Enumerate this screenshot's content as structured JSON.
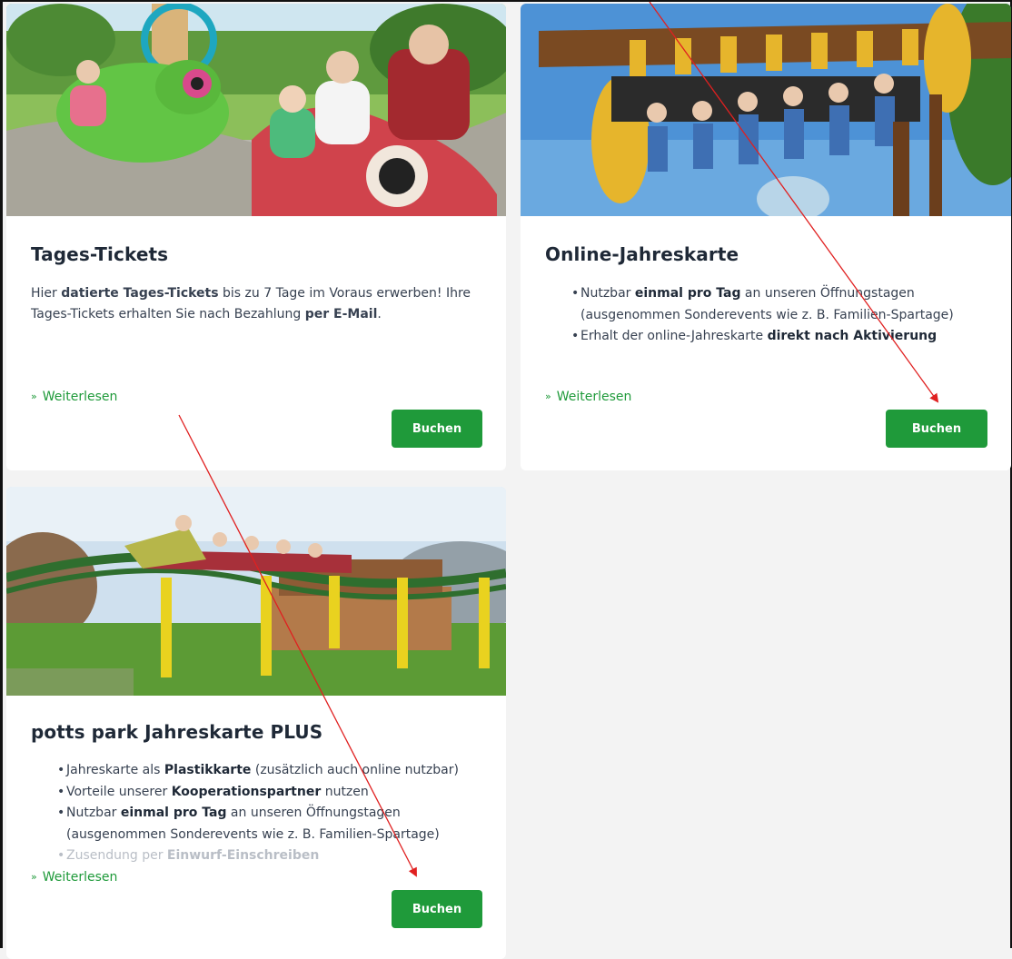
{
  "cards": [
    {
      "title": "Tages-Tickets",
      "text_parts": [
        "Hier ",
        "datierte Tages-Tickets",
        " bis zu 7 Tage im Voraus erwerben! Ihre Tages-Tickets erhalten Sie nach Bezahlung ",
        "per E-Mail",
        "."
      ],
      "more": "Weiterlesen",
      "button": "Buchen"
    },
    {
      "title": "Online-Jahreskarte",
      "bullets": [
        {
          "parts": [
            "Nutzbar ",
            "einmal pro Tag",
            " an unseren Öffnungstagen (ausgenommen Sonderevents wie z. B. Familien-Spartage)"
          ]
        },
        {
          "parts": [
            "Erhalt der online-Jahreskarte ",
            "direkt nach Aktivierung",
            ""
          ]
        }
      ],
      "more": "Weiterlesen",
      "button": "Buchen"
    },
    {
      "title": "potts park Jahreskarte PLUS",
      "bullets": [
        {
          "parts": [
            "Jahreskarte als ",
            "Plastikkarte",
            " (zusätzlich auch online nutzbar)"
          ]
        },
        {
          "parts": [
            "Vorteile unserer ",
            "Kooperationspartner",
            " nutzen"
          ]
        },
        {
          "parts": [
            "Nutzbar ",
            "einmal pro Tag",
            " an unseren Öffnungstagen (ausgenommen Sonderevents wie z. B. Familien-Spartage)"
          ]
        },
        {
          "parts": [
            "Zusendung per ",
            "Einwurf-Einschreiben",
            ""
          ]
        }
      ],
      "more": "Weiterlesen",
      "button": "Buchen"
    }
  ],
  "icons": {
    "more": "double-chevron-down-icon"
  },
  "colors": {
    "accent": "#1f9a3a",
    "annotation": "#e02020"
  }
}
